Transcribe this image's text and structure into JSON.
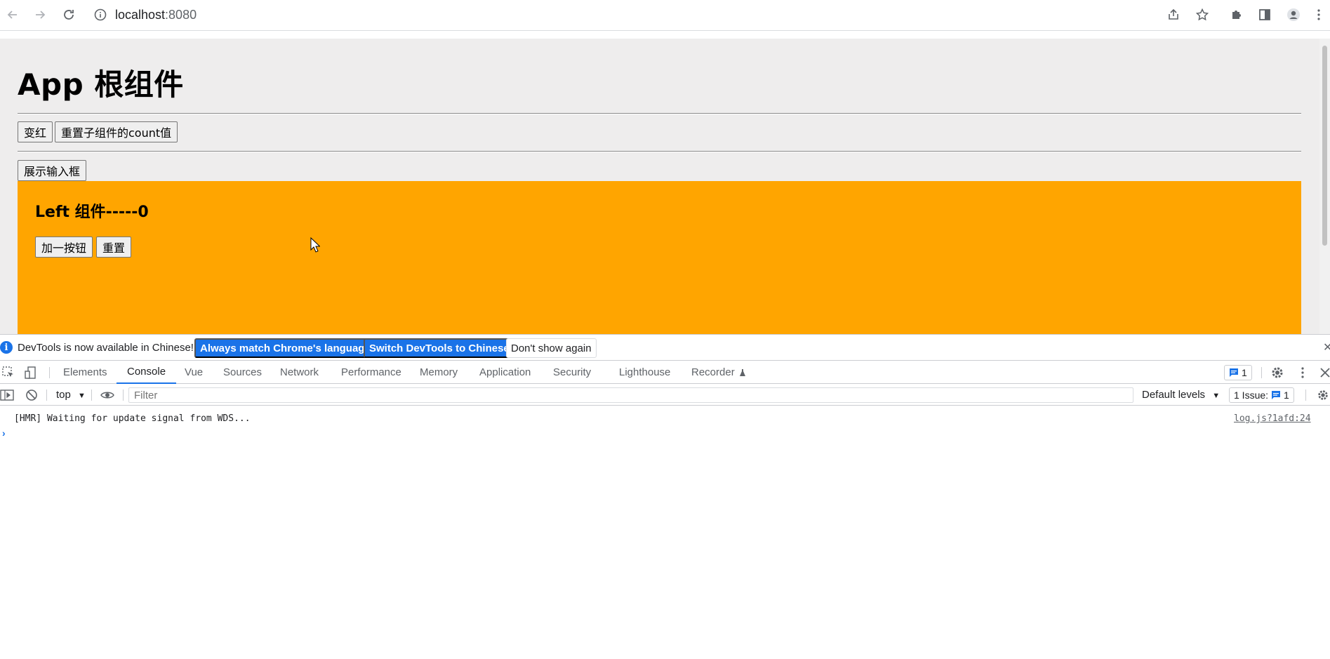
{
  "browser": {
    "url_host": "localhost",
    "url_port": ":8080"
  },
  "page": {
    "title": "App 根组件",
    "buttons": {
      "turn_red": "变红",
      "reset_child_count": "重置子组件的count值",
      "show_input": "展示输入框"
    },
    "left": {
      "title": "Left 组件-----0",
      "add_one": "加一按钮",
      "reset": "重置",
      "bg_color": "#ffa500"
    }
  },
  "devtools": {
    "infobar": {
      "message": "DevTools is now available in Chinese!",
      "match_language": "Always match Chrome's language",
      "switch_chinese": "Switch DevTools to Chinese",
      "dont_show": "Don't show again"
    },
    "tabs": [
      {
        "label": "Elements"
      },
      {
        "label": "Console"
      },
      {
        "label": "Vue"
      },
      {
        "label": "Sources"
      },
      {
        "label": "Network"
      },
      {
        "label": "Performance"
      },
      {
        "label": "Memory"
      },
      {
        "label": "Application"
      },
      {
        "label": "Security"
      },
      {
        "label": "Lighthouse"
      },
      {
        "label": "Recorder"
      }
    ],
    "message_count": "1",
    "console": {
      "context": "top",
      "filter_placeholder": "Filter",
      "levels": "Default levels",
      "issues_label": "1 Issue:",
      "issues_count": "1",
      "log_message": "[HMR] Waiting for update signal from WDS...",
      "log_source": "log.js?1afd:24"
    },
    "accent_color": "#1a73e8"
  }
}
